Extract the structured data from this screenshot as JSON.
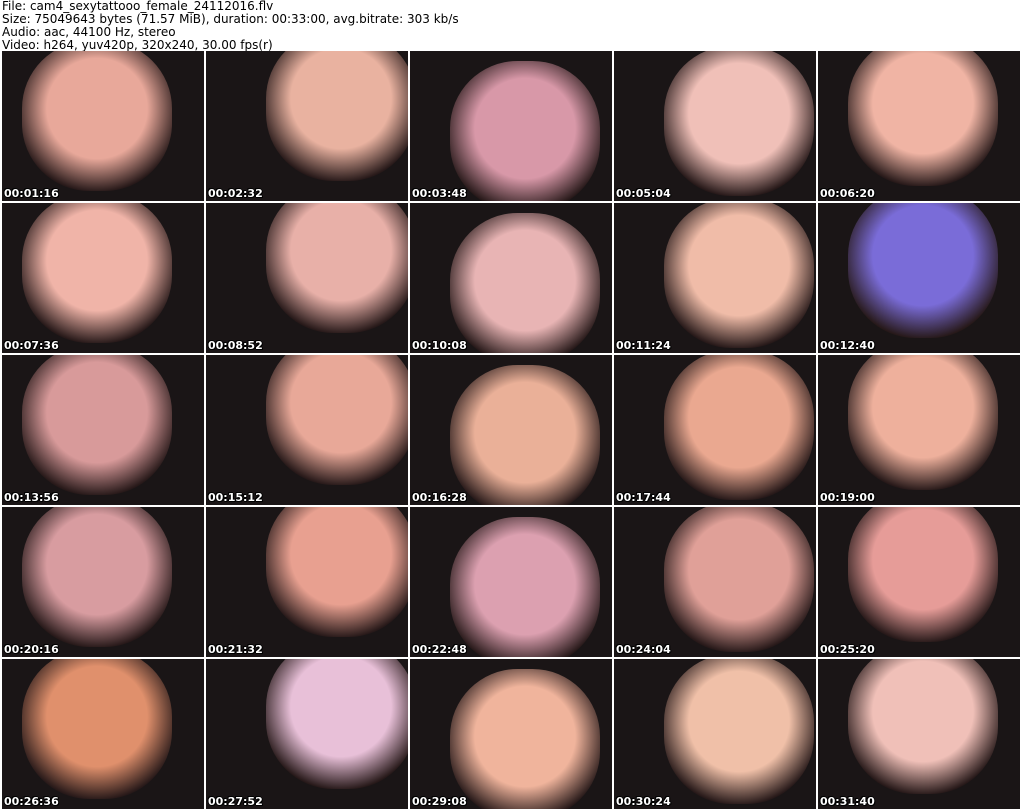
{
  "header": {
    "file": "File: cam4_sexytattooo_female_24112016.flv",
    "size": "Size: 75049643 bytes (71.57 MiB), duration: 00:33:00, avg.bitrate: 303 kb/s",
    "audio": "Audio: aac, 44100 Hz, stereo",
    "video": "Video: h264, yuv420p, 320x240, 30.00 fps(r)"
  },
  "thumbnails": [
    {
      "time": "00:01:16",
      "tone": "#e8a89a"
    },
    {
      "time": "00:02:32",
      "tone": "#e9b2a0"
    },
    {
      "time": "00:03:48",
      "tone": "#d898a8"
    },
    {
      "time": "00:05:04",
      "tone": "#f0c0b8"
    },
    {
      "time": "00:06:20",
      "tone": "#f0b4a4"
    },
    {
      "time": "00:07:36",
      "tone": "#f0b4a8"
    },
    {
      "time": "00:08:52",
      "tone": "#e8b0a8"
    },
    {
      "time": "00:10:08",
      "tone": "#e8b4b4"
    },
    {
      "time": "00:11:24",
      "tone": "#f0bca8"
    },
    {
      "time": "00:12:40",
      "tone": "#7a6cd8"
    },
    {
      "time": "00:13:56",
      "tone": "#d89a9a"
    },
    {
      "time": "00:15:12",
      "tone": "#e8a898"
    },
    {
      "time": "00:16:28",
      "tone": "#eab098"
    },
    {
      "time": "00:17:44",
      "tone": "#eaa890"
    },
    {
      "time": "00:19:00",
      "tone": "#eeb09c"
    },
    {
      "time": "00:20:16",
      "tone": "#d89ca0"
    },
    {
      "time": "00:21:32",
      "tone": "#e8a090"
    },
    {
      "time": "00:22:48",
      "tone": "#dca0b0"
    },
    {
      "time": "00:24:04",
      "tone": "#e0a098"
    },
    {
      "time": "00:25:20",
      "tone": "#e69c98"
    },
    {
      "time": "00:26:36",
      "tone": "#e0906c"
    },
    {
      "time": "00:27:52",
      "tone": "#e8c0d8"
    },
    {
      "time": "00:29:08",
      "tone": "#f0b49c"
    },
    {
      "time": "00:30:24",
      "tone": "#f0c0a8"
    },
    {
      "time": "00:31:40",
      "tone": "#f0c0b8"
    }
  ]
}
